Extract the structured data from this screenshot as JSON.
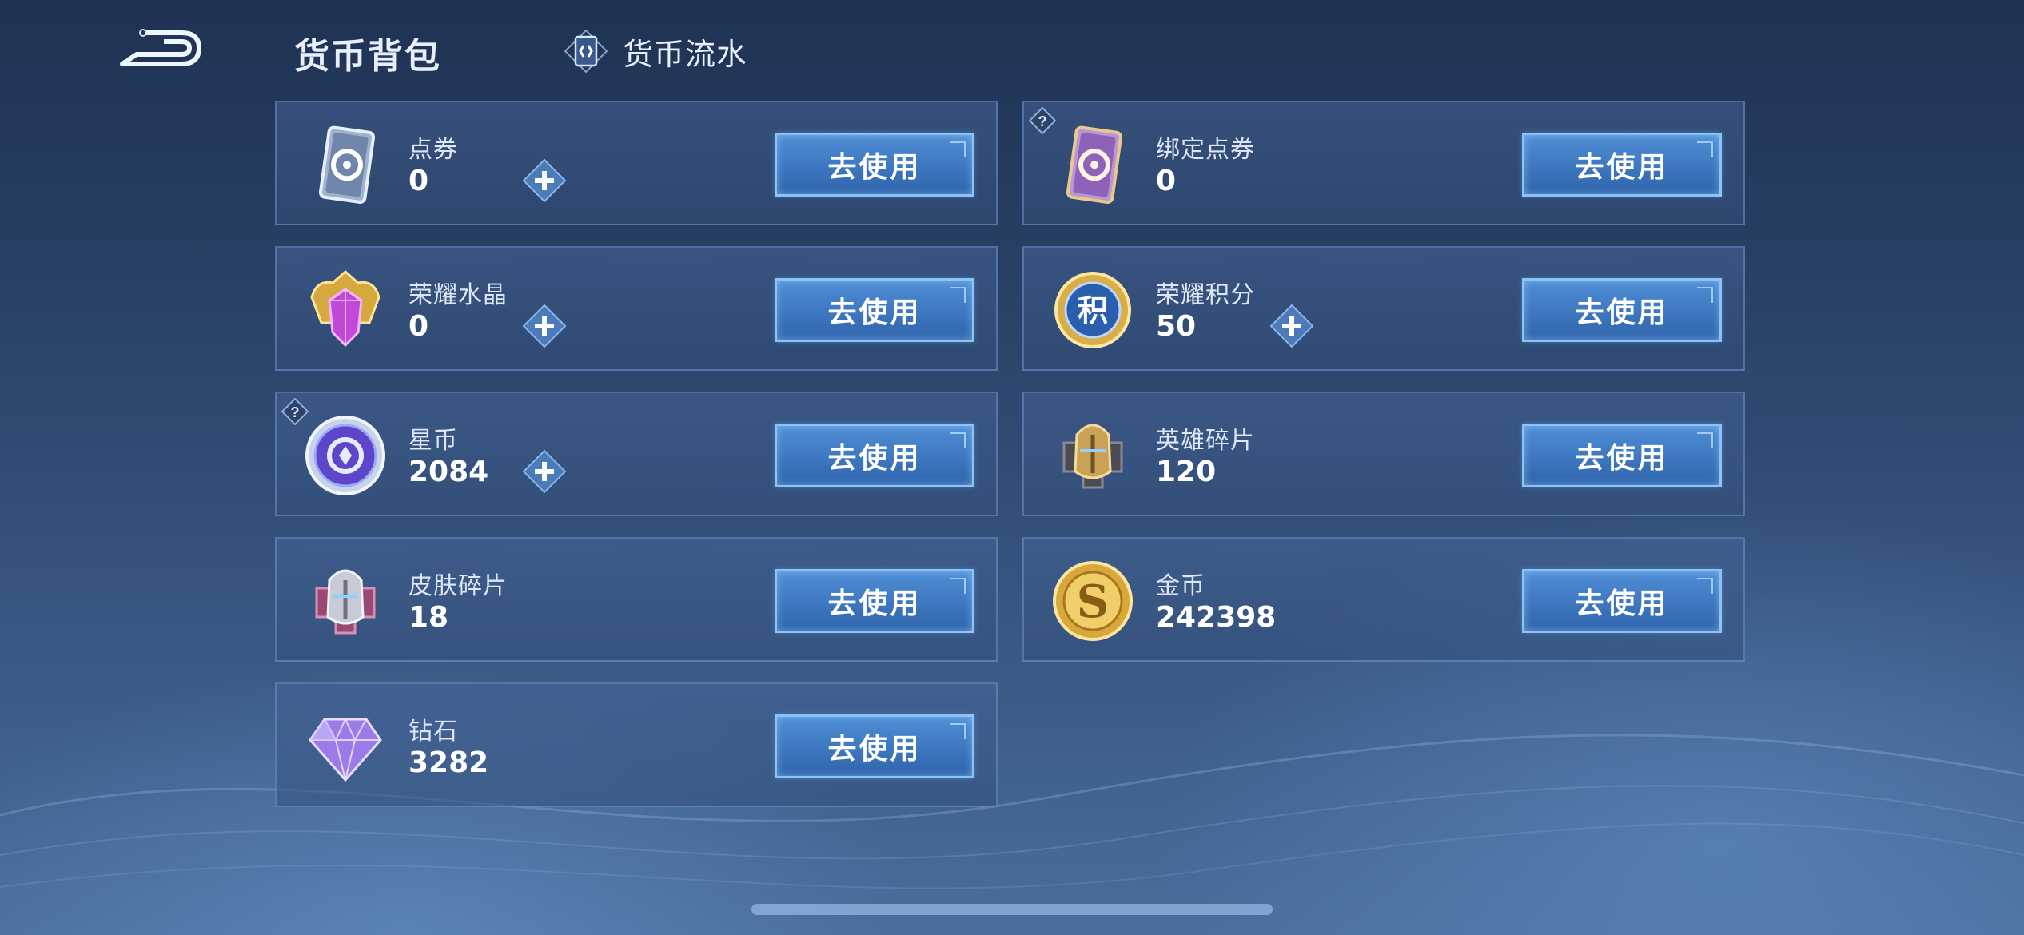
{
  "header": {
    "title": "货币背包",
    "flow_tab_label": "货币流水"
  },
  "use_button_label": "去使用",
  "items": [
    {
      "name": "点券",
      "value": "0",
      "icon": "coupon-card-icon",
      "has_add": true,
      "has_help": false
    },
    {
      "name": "绑定点券",
      "value": "0",
      "icon": "bound-coupon-card-icon",
      "has_add": false,
      "has_help": true
    },
    {
      "name": "荣耀水晶",
      "value": "0",
      "icon": "glory-crystal-icon",
      "has_add": true,
      "has_help": false
    },
    {
      "name": "荣耀积分",
      "value": "50",
      "icon": "glory-points-icon",
      "has_add": true,
      "has_help": false
    },
    {
      "name": "星币",
      "value": "2084",
      "icon": "star-coin-icon",
      "has_add": true,
      "has_help": true
    },
    {
      "name": "英雄碎片",
      "value": "120",
      "icon": "hero-fragment-icon",
      "has_add": false,
      "has_help": false
    },
    {
      "name": "皮肤碎片",
      "value": "18",
      "icon": "skin-fragment-icon",
      "has_add": false,
      "has_help": false
    },
    {
      "name": "金币",
      "value": "242398",
      "icon": "gold-coin-icon",
      "has_add": false,
      "has_help": false
    },
    {
      "name": "钻石",
      "value": "3282",
      "icon": "diamond-icon",
      "has_add": false,
      "has_help": false
    }
  ],
  "colors": {
    "accent": "#4f8ed6",
    "accent_border": "#8cc3f5",
    "background_top": "#1f3253",
    "background_bottom": "#4a6e9c"
  }
}
